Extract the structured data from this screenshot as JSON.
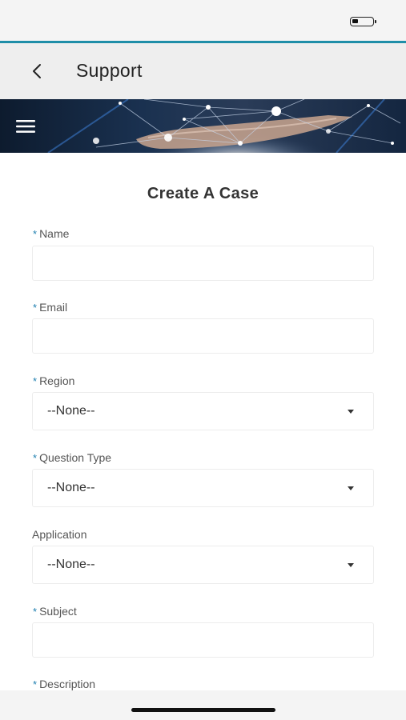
{
  "header": {
    "title": "Support"
  },
  "icons": {
    "back": "chevron-left-icon",
    "menu": "hamburger-menu-icon",
    "battery": "battery-icon"
  },
  "colors": {
    "accent": "#1f8ea8",
    "required_marker": "#1f7fb0"
  },
  "form": {
    "title": "Create A Case",
    "required_marker": "*",
    "fields": {
      "name": {
        "label": "Name",
        "required": true,
        "value": ""
      },
      "email": {
        "label": "Email",
        "required": true,
        "value": ""
      },
      "region": {
        "label": "Region",
        "required": true,
        "selected": "--None--"
      },
      "question_type": {
        "label": "Question Type",
        "required": true,
        "selected": "--None--"
      },
      "application": {
        "label": "Application",
        "required": false,
        "selected": "--None--"
      },
      "subject": {
        "label": "Subject",
        "required": true,
        "value": ""
      },
      "description": {
        "label": "Description",
        "required": true
      }
    }
  }
}
